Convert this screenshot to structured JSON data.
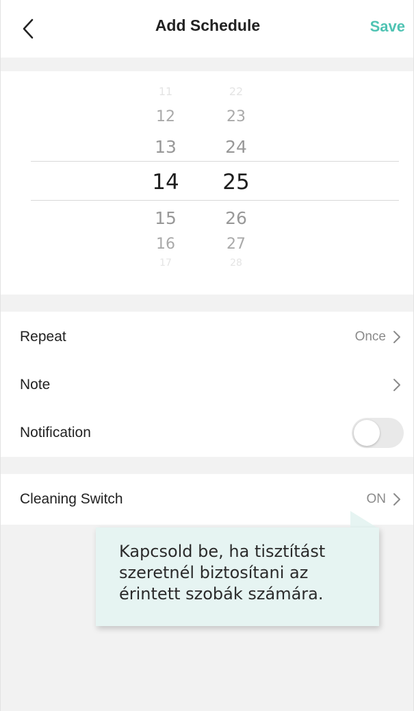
{
  "header": {
    "back_icon": "chevron-left-icon",
    "title": "Add Schedule",
    "save_label": "Save"
  },
  "picker": {
    "hours": [
      "11",
      "12",
      "13",
      "14",
      "15",
      "16",
      "17"
    ],
    "minutes": [
      "22",
      "23",
      "24",
      "25",
      "26",
      "27",
      "28"
    ],
    "selected_hour": "14",
    "selected_minute": "25"
  },
  "rows": {
    "repeat": {
      "label": "Repeat",
      "value": "Once"
    },
    "note": {
      "label": "Note",
      "value": ""
    },
    "notification": {
      "label": "Notification",
      "enabled": false
    },
    "cleaning_switch": {
      "label": "Cleaning Switch",
      "value": "ON"
    }
  },
  "tooltip": {
    "lines": [
      "Kapcsold be, ha tisztítást",
      "szeretnél biztosítani az",
      "érintett szobák számára."
    ]
  },
  "colors": {
    "accent": "#4fc3b3",
    "background": "#f2f2f2",
    "tooltip_bg": "#e6f4f2",
    "toggle_off": "#e9e9e9"
  }
}
